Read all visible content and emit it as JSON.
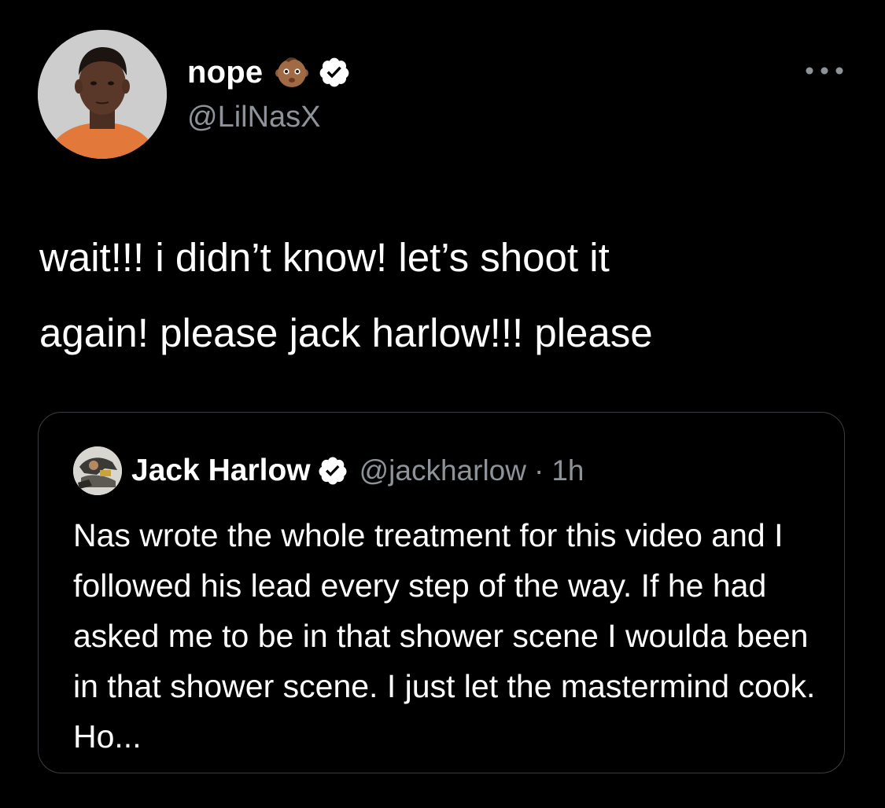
{
  "tweet": {
    "author": {
      "display_name": "nope",
      "emoji_icon": "baby-face-emoji",
      "verified_icon": "verified-badge-icon",
      "handle": "@LilNasX"
    },
    "more_icon": "more-options-icon",
    "text": "wait!!! i didn’t know! let’s shoot it\nagain! please jack harlow!!!  please"
  },
  "quoted_tweet": {
    "author": {
      "display_name": "Jack Harlow",
      "verified_icon": "verified-badge-icon",
      "handle": "@jackharlow",
      "separator": "·",
      "time": "1h"
    },
    "text": "Nas wrote the whole treatment for this video and I followed his lead every step of the way. If he had asked me to be in that shower scene I woulda been in that shower scene. I just let the mastermind cook. Ho..."
  },
  "colors": {
    "background": "#000000",
    "text_primary": "#ffffff",
    "text_secondary": "#8e9399",
    "card_border": "#3a3d41",
    "verified_badge": "#ffffff"
  }
}
